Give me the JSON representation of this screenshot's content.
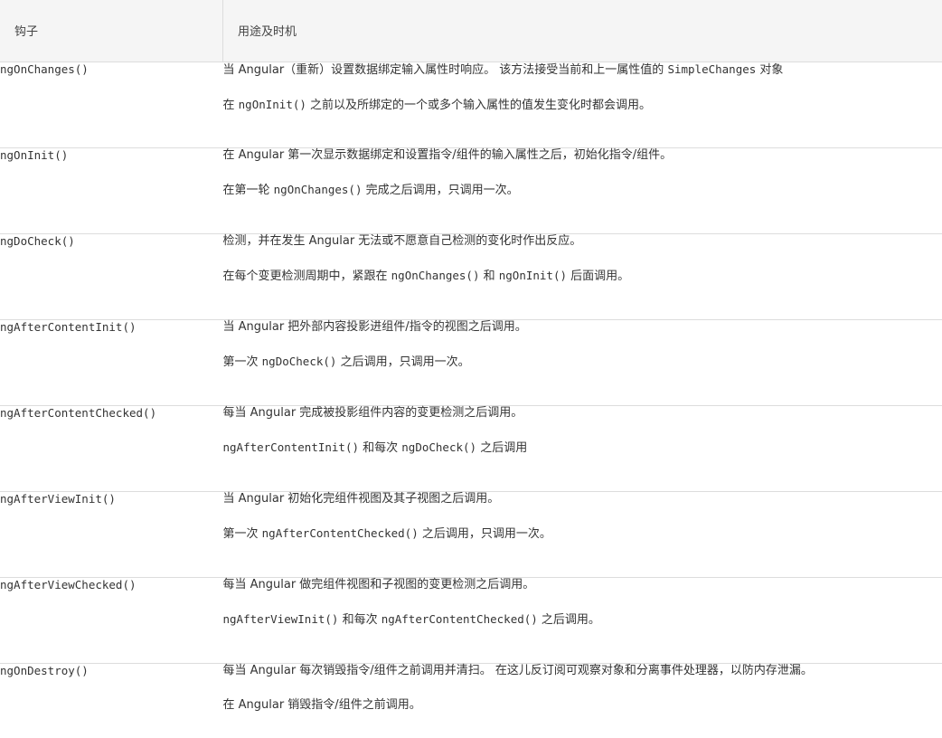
{
  "header": {
    "col_hook": "钩子",
    "col_usage": "用途及时机"
  },
  "rows": [
    {
      "hook": "ngOnChanges()",
      "line1": [
        {
          "t": "当 Angular（重新）设置数据绑定输入属性时响应。 该方法接受当前和上一属性值的 "
        },
        {
          "t": "SimpleChanges",
          "code": true
        },
        {
          "t": " 对象"
        }
      ],
      "line2": [
        {
          "t": "在 "
        },
        {
          "t": "ngOnInit()",
          "code": true
        },
        {
          "t": " 之前以及所绑定的一个或多个输入属性的值发生变化时都会调用。"
        }
      ]
    },
    {
      "hook": "ngOnInit()",
      "line1": [
        {
          "t": "在 Angular 第一次显示数据绑定和设置指令/组件的输入属性之后，初始化指令/组件。"
        }
      ],
      "line2": [
        {
          "t": "在第一轮 "
        },
        {
          "t": "ngOnChanges()",
          "code": true
        },
        {
          "t": " 完成之后调用，只调用一次。"
        }
      ]
    },
    {
      "hook": "ngDoCheck()",
      "line1": [
        {
          "t": "检测，并在发生 Angular 无法或不愿意自己检测的变化时作出反应。"
        }
      ],
      "line2": [
        {
          "t": "在每个变更检测周期中，紧跟在 "
        },
        {
          "t": "ngOnChanges()",
          "code": true
        },
        {
          "t": " 和 "
        },
        {
          "t": "ngOnInit()",
          "code": true
        },
        {
          "t": " 后面调用。"
        }
      ]
    },
    {
      "hook": "ngAfterContentInit()",
      "line1": [
        {
          "t": "当 Angular 把外部内容投影进组件/指令的视图之后调用。"
        }
      ],
      "line2": [
        {
          "t": "第一次 "
        },
        {
          "t": "ngDoCheck()",
          "code": true
        },
        {
          "t": " 之后调用，只调用一次。"
        }
      ]
    },
    {
      "hook": "ngAfterContentChecked()",
      "line1": [
        {
          "t": "每当 Angular 完成被投影组件内容的变更检测之后调用。"
        }
      ],
      "line2": [
        {
          "t": "ngAfterContentInit()",
          "code": true
        },
        {
          "t": " 和每次 "
        },
        {
          "t": "ngDoCheck()",
          "code": true
        },
        {
          "t": " 之后调用"
        }
      ]
    },
    {
      "hook": "ngAfterViewInit()",
      "line1": [
        {
          "t": "当 Angular 初始化完组件视图及其子视图之后调用。"
        }
      ],
      "line2": [
        {
          "t": "第一次 "
        },
        {
          "t": "ngAfterContentChecked()",
          "code": true
        },
        {
          "t": " 之后调用，只调用一次。"
        }
      ]
    },
    {
      "hook": "ngAfterViewChecked()",
      "line1": [
        {
          "t": "每当 Angular 做完组件视图和子视图的变更检测之后调用。"
        }
      ],
      "line2": [
        {
          "t": "ngAfterViewInit()",
          "code": true
        },
        {
          "t": " 和每次 "
        },
        {
          "t": "ngAfterContentChecked()",
          "code": true
        },
        {
          "t": " 之后调用。"
        }
      ]
    },
    {
      "hook": "ngOnDestroy()",
      "line1": [
        {
          "t": "每当 Angular 每次销毁指令/组件之前调用并清扫。 在这儿反订阅可观察对象和分离事件处理器，以防内存泄漏。"
        }
      ],
      "line2": [
        {
          "t": "在 Angular 销毁指令/组件之前调用。"
        }
      ]
    }
  ]
}
